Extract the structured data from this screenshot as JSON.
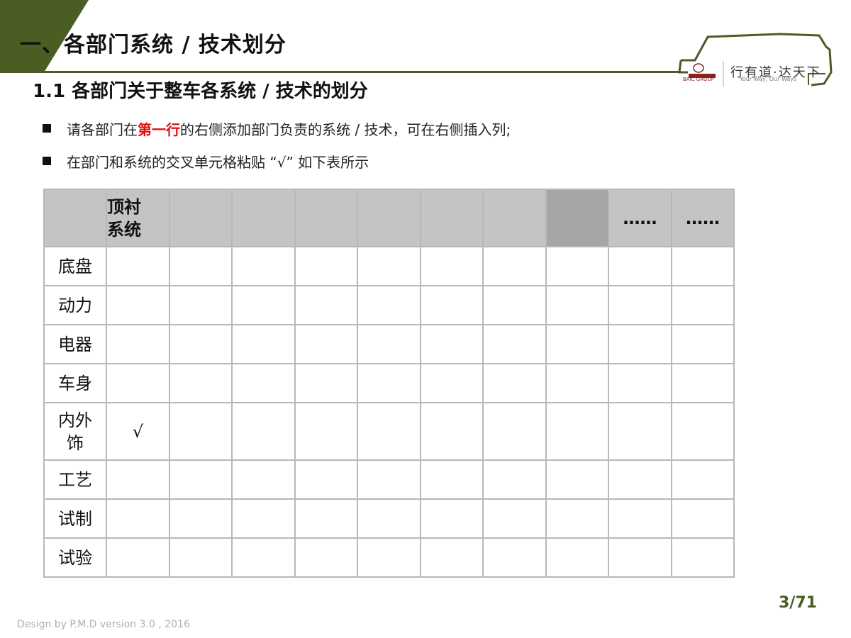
{
  "header": {
    "title": "一、各部门系统 / 技术划分",
    "subtitle": "1.1  各部门关于整车各系统 / 技术的划分"
  },
  "logo": {
    "slogan": "行有道·达天下",
    "slogan_en": "Your Way, Our Ways",
    "brand": "BAIC GROUP"
  },
  "bullets": [
    {
      "before": "请各部门在",
      "highlight": "第一行",
      "after": "的右侧添加部门负责的系统 / 技术，可在右侧插入列;"
    },
    {
      "text": "在部门和系统的交叉单元格粘贴 “√” 如下表所示"
    }
  ],
  "table": {
    "header": [
      "",
      "顶衬系统",
      "",
      "",
      "",
      "",
      "",
      "",
      "",
      "……",
      "……"
    ],
    "rows": [
      {
        "label": "底盘",
        "cells": [
          "",
          "",
          "",
          "",
          "",
          "",
          "",
          "",
          "",
          ""
        ]
      },
      {
        "label": "动力",
        "cells": [
          "",
          "",
          "",
          "",
          "",
          "",
          "",
          "",
          "",
          ""
        ]
      },
      {
        "label": "电器",
        "cells": [
          "",
          "",
          "",
          "",
          "",
          "",
          "",
          "",
          "",
          ""
        ]
      },
      {
        "label": "车身",
        "cells": [
          "",
          "",
          "",
          "",
          "",
          "",
          "",
          "",
          "",
          ""
        ]
      },
      {
        "label": "内外饰",
        "cells": [
          "√",
          "",
          "",
          "",
          "",
          "",
          "",
          "",
          "",
          ""
        ]
      },
      {
        "label": "工艺",
        "cells": [
          "",
          "",
          "",
          "",
          "",
          "",
          "",
          "",
          "",
          ""
        ]
      },
      {
        "label": "试制",
        "cells": [
          "",
          "",
          "",
          "",
          "",
          "",
          "",
          "",
          "",
          ""
        ]
      },
      {
        "label": "试验",
        "cells": [
          "",
          "",
          "",
          "",
          "",
          "",
          "",
          "",
          "",
          ""
        ]
      }
    ]
  },
  "page": {
    "number": "3/71"
  },
  "footer": {
    "text": "Design by P.M.D  version 3.0 ,   2016"
  },
  "colors": {
    "accent": "#4a5d23",
    "highlight": "#e01010",
    "header_cell": "#c4c4c4"
  }
}
